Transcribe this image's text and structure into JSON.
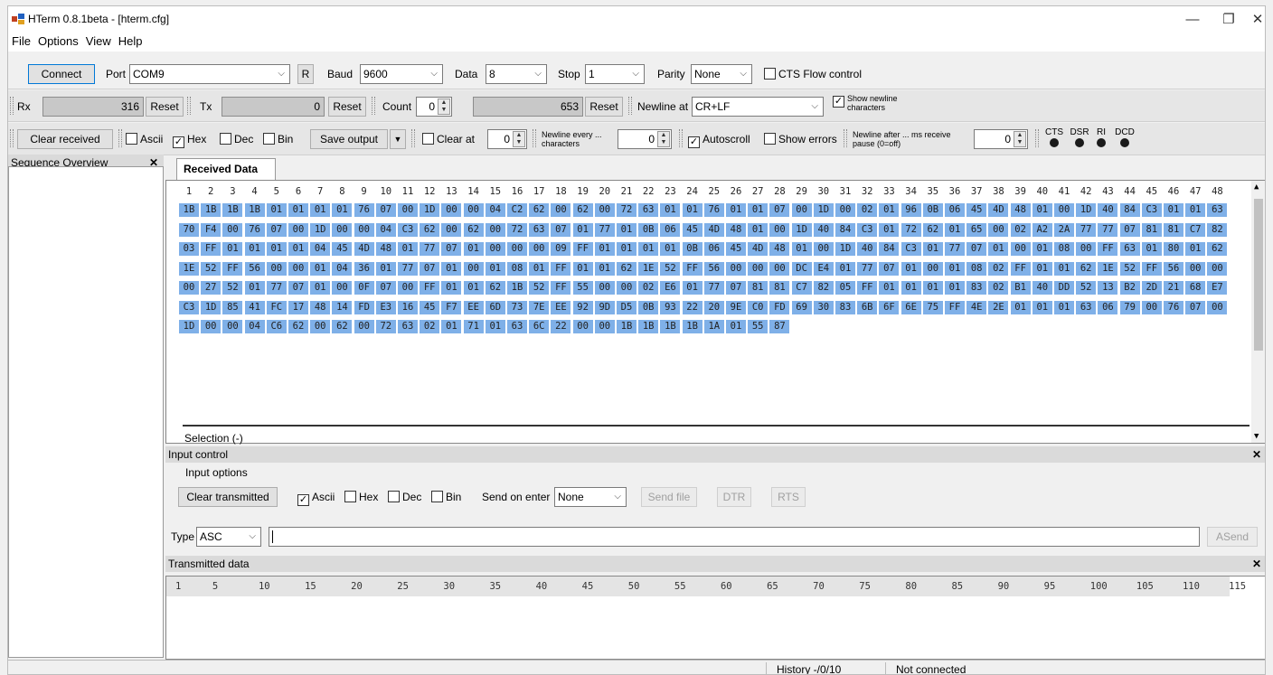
{
  "window": {
    "title": "HTerm 0.8.1beta - [hterm.cfg]"
  },
  "menu": [
    "File",
    "Options",
    "View",
    "Help"
  ],
  "toolbar1": {
    "connect": "Connect",
    "port_label": "Port",
    "port_value": "COM9",
    "r_button": "R",
    "baud_label": "Baud",
    "baud_value": "9600",
    "data_label": "Data",
    "data_value": "8",
    "stop_label": "Stop",
    "stop_value": "1",
    "parity_label": "Parity",
    "parity_value": "None",
    "cts_label": "CTS Flow control"
  },
  "toolbar2": {
    "rx_label": "Rx",
    "rx_value": "316",
    "reset": "Reset",
    "tx_label": "Tx",
    "tx_value": "0",
    "count_label": "Count",
    "count_value": "0",
    "count_field": "653",
    "newline_label": "Newline at",
    "newline_value": "CR+LF",
    "show_newline_label": "Show newline characters"
  },
  "toolbar3": {
    "clear_received": "Clear received",
    "ascii": "Ascii",
    "hex": "Hex",
    "dec": "Dec",
    "bin": "Bin",
    "save_output": "Save output",
    "clear_at": "Clear at",
    "clear_at_value": "0",
    "newline_every": "Newline every ... characters",
    "newline_every_value": "0",
    "autoscroll": "Autoscroll",
    "show_errors": "Show errors",
    "newline_after": "Newline after ... ms receive pause (0=off)",
    "newline_after_value": "0",
    "leds": [
      "CTS",
      "DSR",
      "RI",
      "DCD"
    ]
  },
  "sequence_overview": {
    "title": "Sequence Overview"
  },
  "received": {
    "tab": "Received Data",
    "columns": [
      "1",
      "2",
      "3",
      "4",
      "5",
      "6",
      "7",
      "8",
      "9",
      "10",
      "11",
      "12",
      "13",
      "14",
      "15",
      "16",
      "17",
      "18",
      "19",
      "20",
      "21",
      "22",
      "23",
      "24",
      "25",
      "26",
      "27",
      "28",
      "29",
      "30",
      "31",
      "32",
      "33",
      "34",
      "35",
      "36",
      "37",
      "38",
      "39",
      "40",
      "41",
      "42",
      "43",
      "44",
      "45",
      "46",
      "47",
      "48"
    ],
    "rows": [
      "1B 1B 1B 1B 01 01 01 01 76 07 00 1D 00 00 04 C2 62 00 62 00 72 63 01 01 76 01 01 07 00 1D 00 02 01 96 0B 06 45 4D 48 01 00 1D 40 84 C3 01 01 63",
      "70 F4 00 76 07 00 1D 00 00 04 C3 62 00 62 00 72 63 07 01 77 01 0B 06 45 4D 48 01 00 1D 40 84 C3 01 72 62 01 65 00 02 A2 2A 77 77 07 81 81 C7 82",
      "03 FF 01 01 01 01 04 45 4D 48 01 77 07 01 00 00 00 09 FF 01 01 01 01 0B 06 45 4D 48 01 00 1D 40 84 C3 01 77 07 01 00 01 08 00 FF 63 01 80 01 62",
      "1E 52 FF 56 00 00 01 04 36 01 77 07 01 00 01 08 01 FF 01 01 62 1E 52 FF 56 00 00 00 DC E4 01 77 07 01 00 01 08 02 FF 01 01 62 1E 52 FF 56 00 00",
      "00 27 52 01 77 07 01 00 0F 07 00 FF 01 01 62 1B 52 FF 55 00 00 02 E6 01 77 07 81 81 C7 82 05 FF 01 01 01 01 83 02 B1 40 DD 52 13 B2 2D 21 68 E7",
      "C3 1D 85 41 FC 17 48 14 FD E3 16 45 F7 EE 6D 73 7E EE 92 9D D5 0B 93 22 20 9E C0 FD 69 30 83 6B 6F 6E 75 FF 4E 2E 01 01 01 63 06 79 00 76 07 00",
      "1D 00 00 04 C6 62 00 62 00 72 63 02 01 71 01 63 6C 22 00 00 1B 1B 1B 1B 1A 01 55 87"
    ],
    "selection": "Selection (-)"
  },
  "input_control": {
    "title": "Input control",
    "options_label": "Input options",
    "clear_transmitted": "Clear transmitted",
    "ascii": "Ascii",
    "hex": "Hex",
    "dec": "Dec",
    "bin": "Bin",
    "send_on_enter_label": "Send on enter",
    "send_on_enter_value": "None",
    "send_file": "Send file",
    "dtr": "DTR",
    "rts": "RTS",
    "type_label": "Type",
    "type_value": "ASC",
    "asend": "ASend"
  },
  "transmitted": {
    "title": "Transmitted data",
    "ruler": [
      "1",
      "5",
      "10",
      "15",
      "20",
      "25",
      "30",
      "35",
      "40",
      "45",
      "50",
      "55",
      "60",
      "65",
      "70",
      "75",
      "80",
      "85",
      "90",
      "95",
      "100",
      "105",
      "110",
      "115"
    ]
  },
  "status": {
    "history": "History -/0/10",
    "connection": "Not connected"
  }
}
